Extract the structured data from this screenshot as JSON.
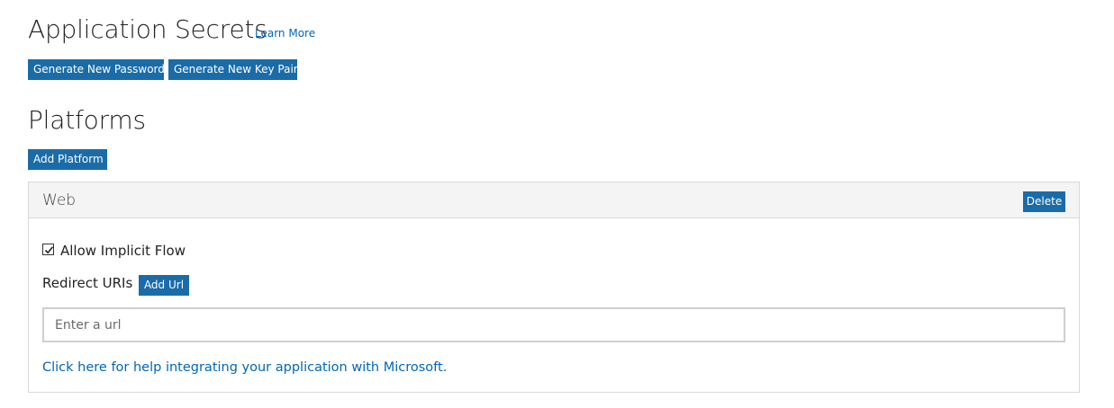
{
  "secrets": {
    "title": "Application Secrets",
    "learn_more": "Learn More",
    "generate_password_label": "Generate New Password",
    "generate_keypair_label": "Generate New Key Pair"
  },
  "platforms": {
    "title": "Platforms",
    "add_platform_label": "Add Platform",
    "web": {
      "header": "Web",
      "delete_label": "Delete",
      "allow_implicit_flow": {
        "label": "Allow Implicit Flow",
        "checked": true
      },
      "redirect_uris_label": "Redirect URIs",
      "add_url_label": "Add Url",
      "url_input": {
        "value": "",
        "placeholder": "Enter a url"
      },
      "help_link": "Click here for help integrating your application with Microsoft."
    }
  },
  "colors": {
    "button_bg": "#1a6ca8",
    "link": "#0067b8",
    "panel_header_bg": "#f4f4f4",
    "border": "#d9d9d9"
  }
}
